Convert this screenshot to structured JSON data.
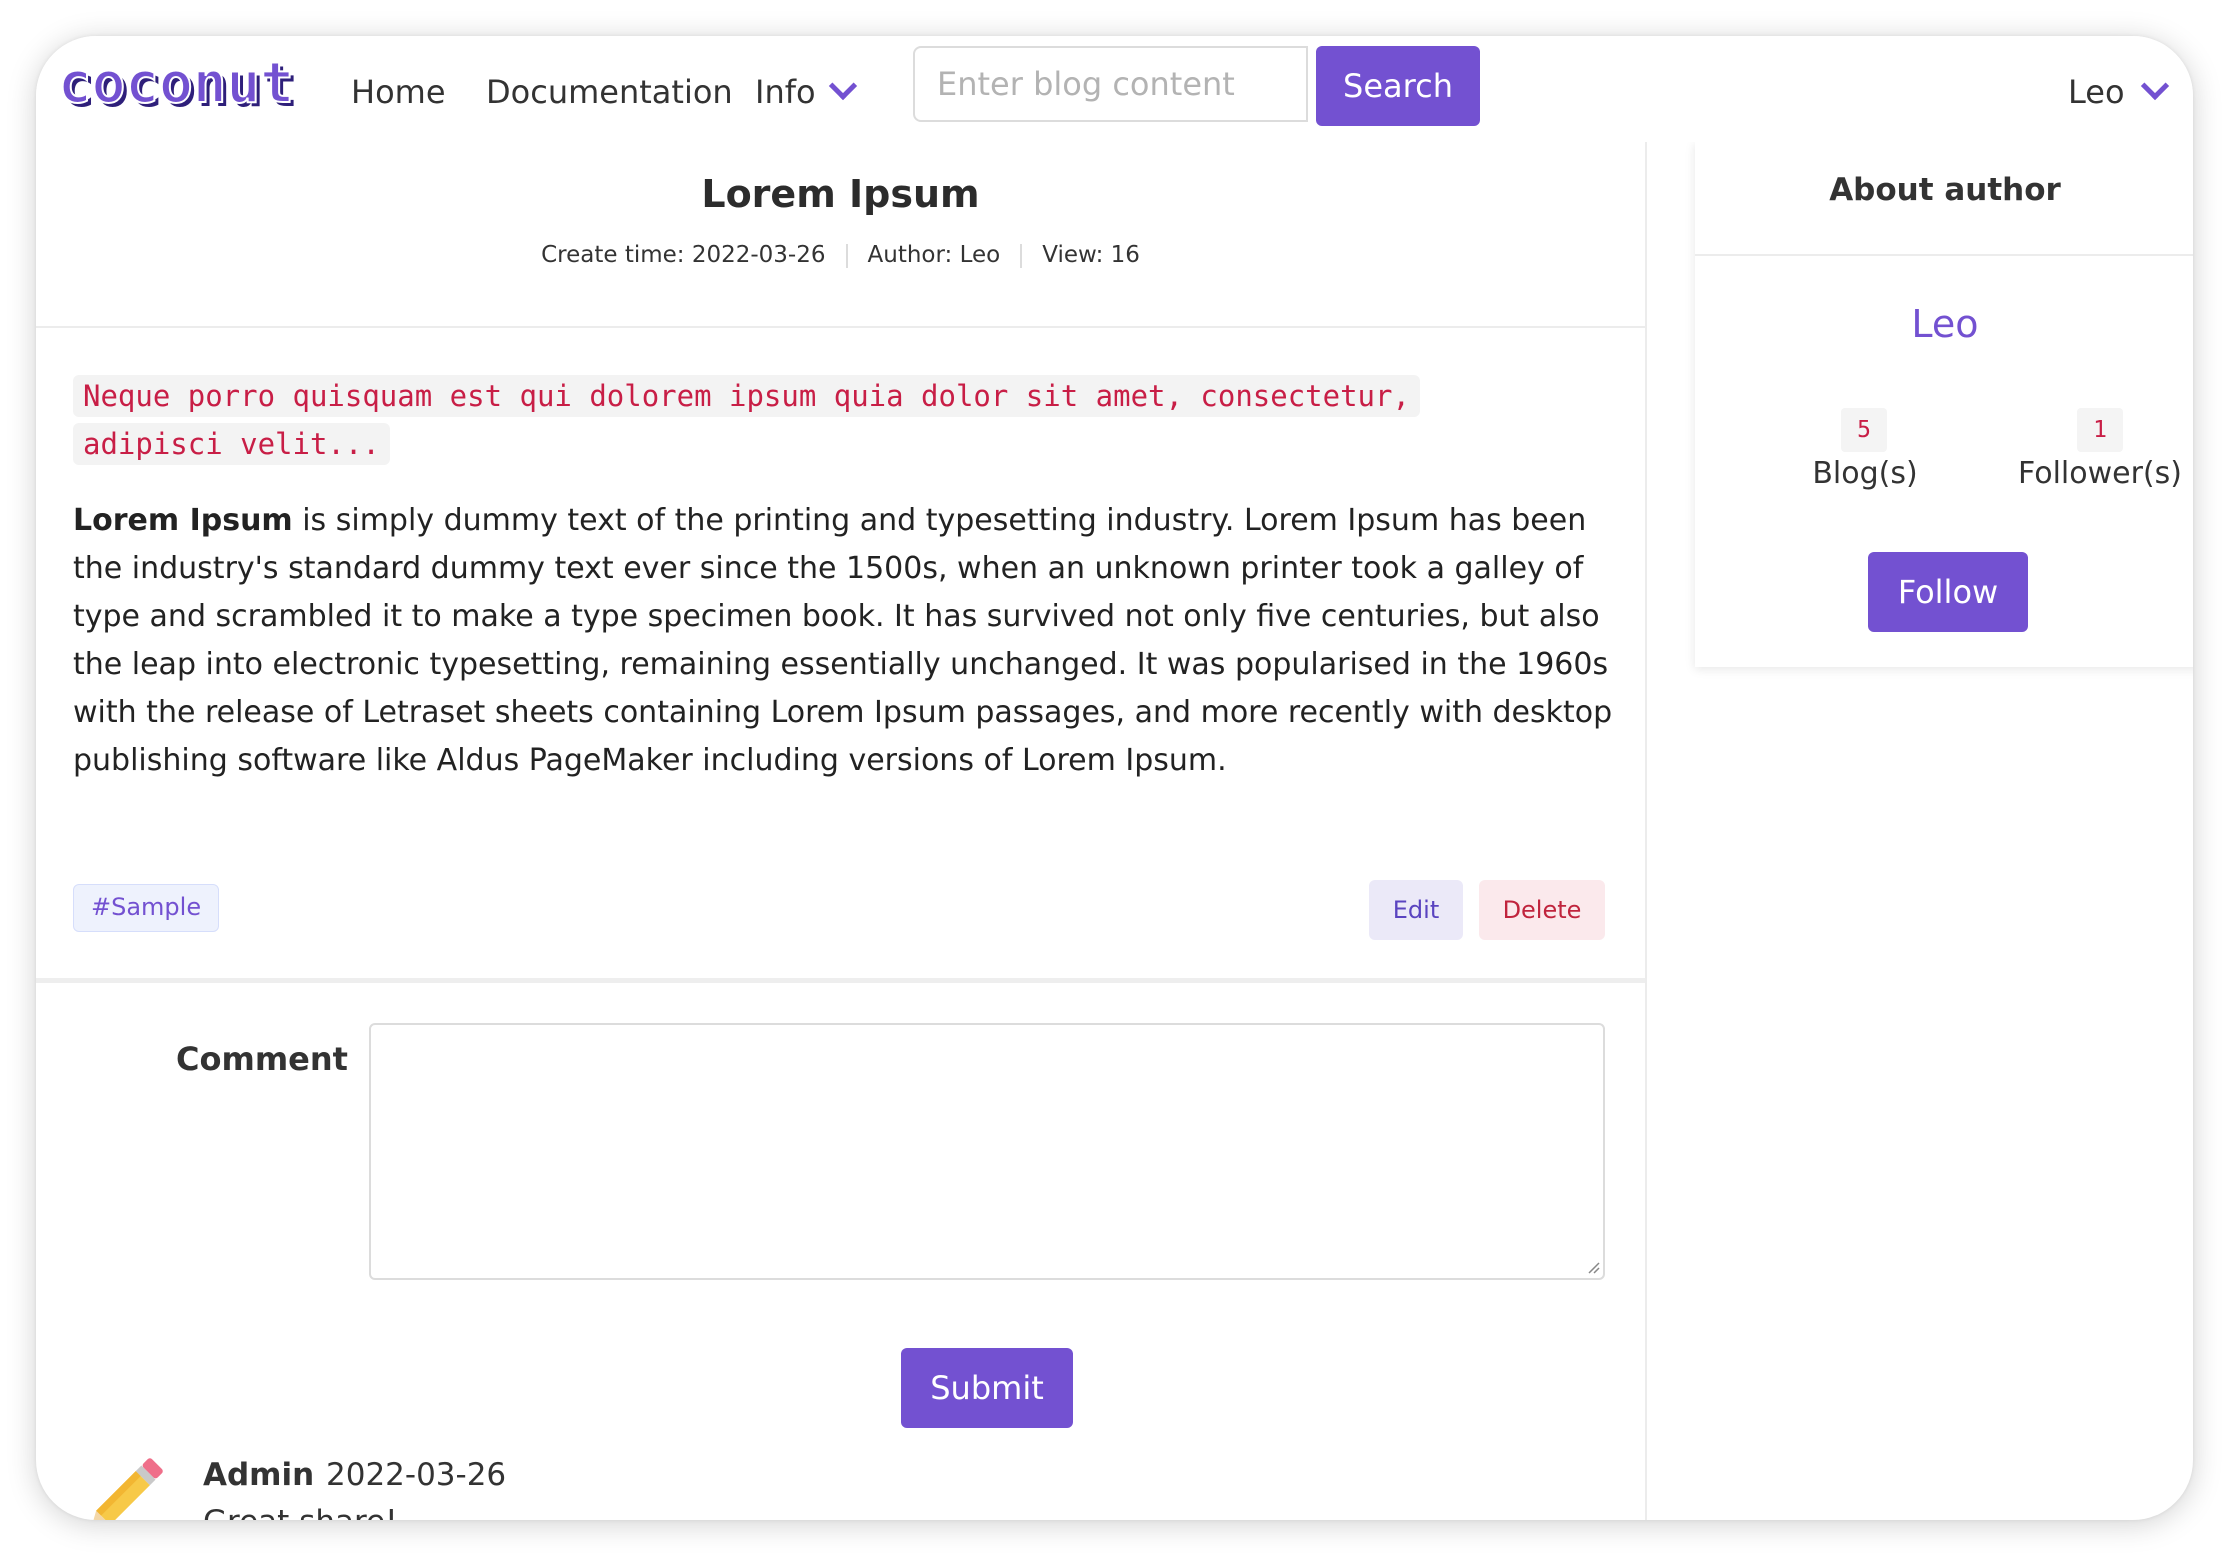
{
  "navbar": {
    "logo_text": "coconut",
    "links": [
      "Home",
      "Documentation",
      "Info"
    ],
    "search_placeholder": "Enter blog content",
    "search_label": "Search",
    "user_name": "Leo"
  },
  "post": {
    "title": "Lorem Ipsum",
    "create_time": "Create time: 2022-03-26",
    "author": "Author: Leo",
    "views": "View: 16",
    "code_quote": "Neque porro quisquam est qui dolorem ipsum quia dolor sit amet, consectetur, adipisci velit...",
    "body_bold": "Lorem Ipsum",
    "body_text": " is simply dummy text of the printing and typesetting industry. Lorem Ipsum has been the industry's standard dummy text ever since the 1500s, when an unknown printer took a galley of type and scrambled it to make a type specimen book. It has survived not only five centuries, but also the leap into electronic typesetting, remaining essentially unchanged. It was popularised in the 1960s with the release of Letraset sheets containing Lorem Ipsum passages, and more recently with desktop publishing software like Aldus PageMaker including versions of Lorem Ipsum.",
    "tag": "#Sample",
    "edit_label": "Edit",
    "delete_label": "Delete"
  },
  "comment_form": {
    "label": "Comment",
    "value": "",
    "submit_label": "Submit"
  },
  "comments": [
    {
      "author": "Admin",
      "date": "2022-03-26",
      "text": "Great share!",
      "avatar_icon": "pencil-icon"
    }
  ],
  "sidebar": {
    "title": "About author",
    "author_name": "Leo",
    "blogs_count": "5",
    "blogs_label": "Blog(s)",
    "followers_count": "1",
    "followers_label": "Follower(s)",
    "follow_label": "Follow"
  },
  "colors": {
    "accent": "#7351d1",
    "code": "#c81e46",
    "delete": "#c0243d"
  }
}
